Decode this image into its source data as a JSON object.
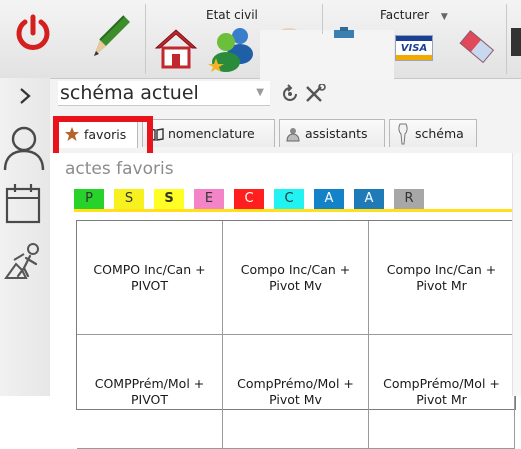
{
  "toolbar": {
    "groups": {
      "etat_civil": "Etat civil",
      "facturer": "Facturer"
    },
    "buttons": [
      {
        "name": "power-button",
        "icon": "power-icon",
        "color": "#d41f1f"
      },
      {
        "name": "edit-button",
        "icon": "pencil-icon",
        "color": "#3e8d2d"
      },
      {
        "name": "home-button",
        "icon": "house-icon",
        "color": "#c1272d"
      },
      {
        "name": "patients-button",
        "icon": "users-icon",
        "color": "#2a8c3a"
      },
      {
        "name": "visa-button",
        "icon": "visa-card-icon",
        "color": "#1a3f94"
      },
      {
        "name": "eraser-button",
        "icon": "eraser-icon",
        "color": "#e0495a"
      }
    ],
    "visa_text": "VISA"
  },
  "schema": {
    "value": "schéma actuel"
  },
  "tabs": [
    {
      "label": "favoris",
      "icon": "star-icon",
      "active": true
    },
    {
      "label": "nomenclature",
      "icon": "book-icon",
      "active": false
    },
    {
      "label": "assistants",
      "icon": "wizard-icon",
      "active": false
    },
    {
      "label": "schéma",
      "icon": "tooth-icon",
      "active": false
    }
  ],
  "favoris": {
    "title": "actes favoris",
    "colors": [
      {
        "label": "P",
        "bg": "#27d32a",
        "bold": false
      },
      {
        "label": "S",
        "bg": "#f7f21f",
        "bold": false
      },
      {
        "label": "S",
        "bg": "#ffff25",
        "bold": true
      },
      {
        "label": "E",
        "bg": "#f384c7",
        "bold": false
      },
      {
        "label": "C",
        "bg": "#ff1f1f",
        "bold": false
      },
      {
        "label": "C",
        "bg": "#21f3f3",
        "bold": false
      },
      {
        "label": "A",
        "bg": "#1482c9",
        "bold": false
      },
      {
        "label": "A",
        "bg": "#1f7ab8",
        "bold": false
      },
      {
        "label": "R",
        "bg": "#a7a7a7",
        "bold": false
      }
    ],
    "acts": [
      "COMPO Inc/Can +\nPIVOT",
      "Compo Inc/Can +\nPivot Mv",
      "Compo Inc/Can +\nPivot Mr",
      "COMPPrém/Mol +\nPIVOT",
      "CompPrémo/Mol +\nPivot Mv",
      "CompPrémo/Mol +\nPivot Mr"
    ]
  },
  "sidebar": {
    "items": [
      {
        "name": "collapse-button",
        "icon": "chevron-right-icon"
      },
      {
        "name": "patient-button",
        "icon": "person-icon"
      },
      {
        "name": "calendar-button",
        "icon": "calendar-icon"
      },
      {
        "name": "work-button",
        "icon": "worker-icon"
      }
    ]
  },
  "accent": {
    "highlight": "#e8131b",
    "strip_underline": "#ffe01a"
  }
}
